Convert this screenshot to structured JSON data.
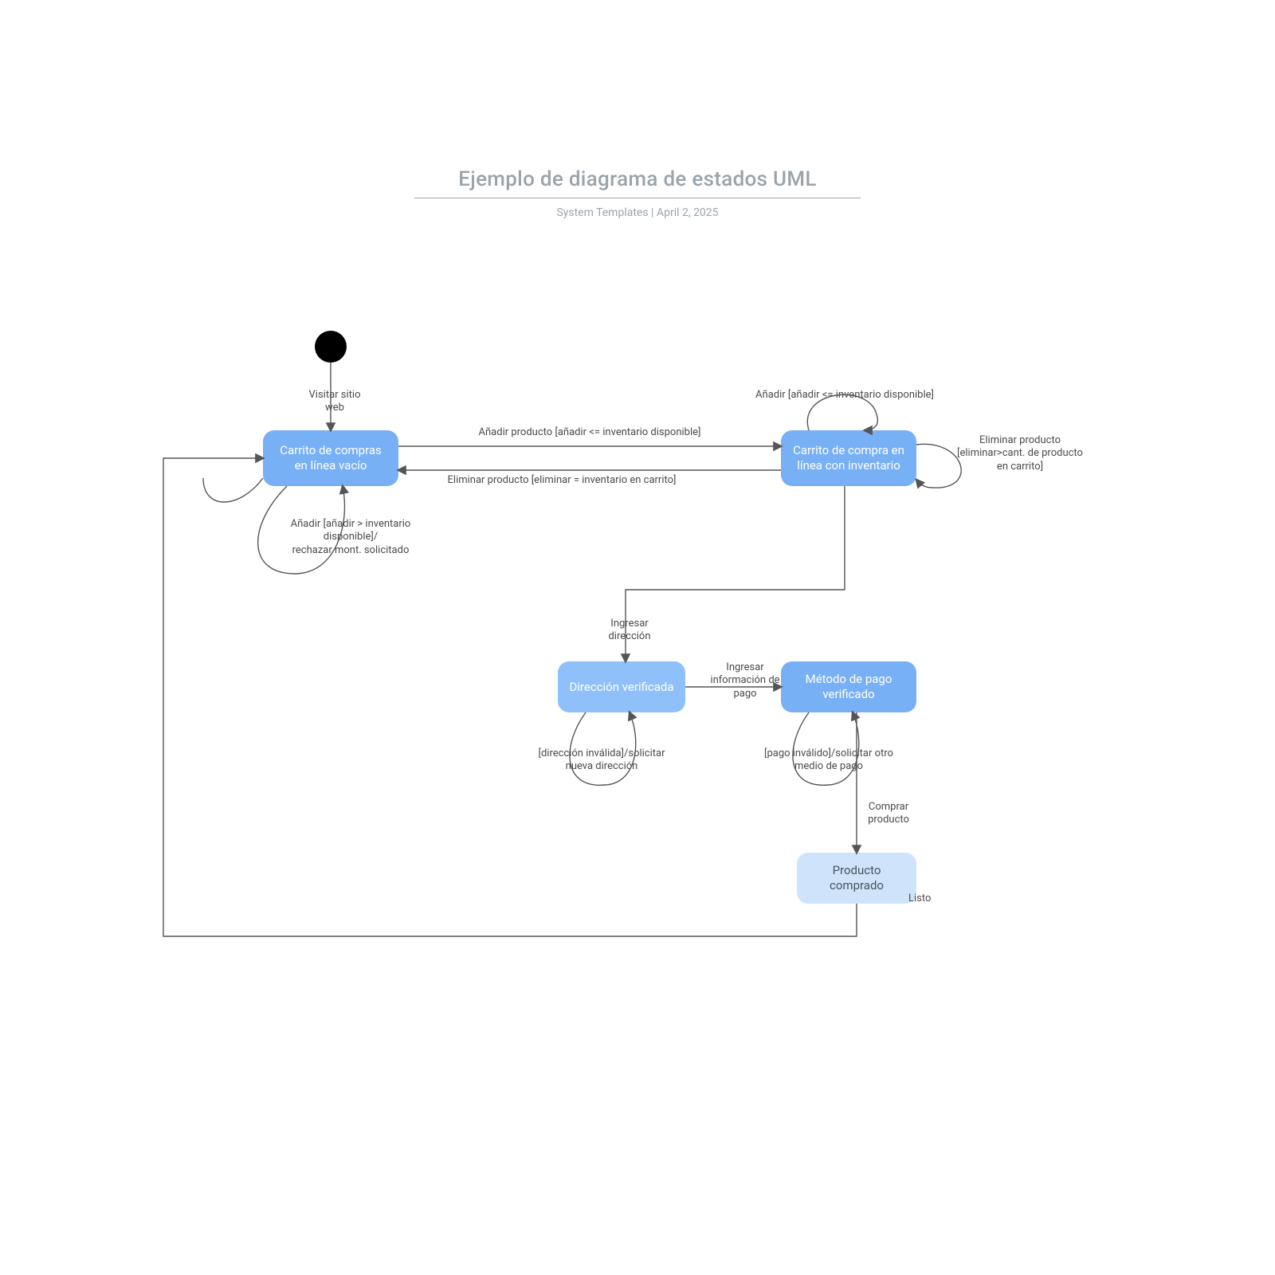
{
  "header": {
    "title": "Ejemplo de diagrama de estados UML",
    "meta_author": "System Templates",
    "meta_sep": "  |  ",
    "meta_date": "April 2, 2025"
  },
  "states": {
    "empty_cart": "Carrito de compras en línea vacío",
    "cart_inv": "Carrito de compra en línea con inventario",
    "addr": "Dirección verificada",
    "payment": "Método de pago verificado",
    "purchased": "Producto comprado"
  },
  "transitions": {
    "visit": "Visitar sitio web",
    "add_ok": "Añadir producto [añadir <= inventario disponible]",
    "remove_eq": "Eliminar producto [eliminar = inventario en carrito]",
    "add_reject": "Añadir [añadir > inventario disponible]/\nrechazar mont. solicitado",
    "self_add_inv": "Añadir [añadir <= inventario disponible]",
    "remove_gt": "Eliminar producto [eliminar>cant. de producto en carrito]",
    "enter_addr": "Ingresar dirección",
    "addr_invalid": "[dirección inválida]/solicitar nueva dirección",
    "enter_pay": "Ingresar información de pago",
    "pay_invalid": "[pago inválido]/solicitar otro medio de pago",
    "buy": "Comprar producto",
    "done": "Listo"
  }
}
